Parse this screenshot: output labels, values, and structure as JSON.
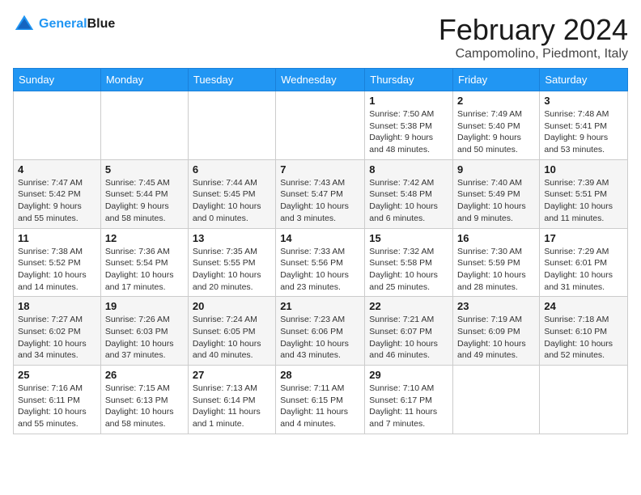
{
  "header": {
    "logo_line1": "General",
    "logo_line2": "Blue",
    "month_year": "February 2024",
    "location": "Campomolino, Piedmont, Italy"
  },
  "weekdays": [
    "Sunday",
    "Monday",
    "Tuesday",
    "Wednesday",
    "Thursday",
    "Friday",
    "Saturday"
  ],
  "weeks": [
    [
      {
        "day": "",
        "info": ""
      },
      {
        "day": "",
        "info": ""
      },
      {
        "day": "",
        "info": ""
      },
      {
        "day": "",
        "info": ""
      },
      {
        "day": "1",
        "info": "Sunrise: 7:50 AM\nSunset: 5:38 PM\nDaylight: 9 hours\nand 48 minutes."
      },
      {
        "day": "2",
        "info": "Sunrise: 7:49 AM\nSunset: 5:40 PM\nDaylight: 9 hours\nand 50 minutes."
      },
      {
        "day": "3",
        "info": "Sunrise: 7:48 AM\nSunset: 5:41 PM\nDaylight: 9 hours\nand 53 minutes."
      }
    ],
    [
      {
        "day": "4",
        "info": "Sunrise: 7:47 AM\nSunset: 5:42 PM\nDaylight: 9 hours\nand 55 minutes."
      },
      {
        "day": "5",
        "info": "Sunrise: 7:45 AM\nSunset: 5:44 PM\nDaylight: 9 hours\nand 58 minutes."
      },
      {
        "day": "6",
        "info": "Sunrise: 7:44 AM\nSunset: 5:45 PM\nDaylight: 10 hours\nand 0 minutes."
      },
      {
        "day": "7",
        "info": "Sunrise: 7:43 AM\nSunset: 5:47 PM\nDaylight: 10 hours\nand 3 minutes."
      },
      {
        "day": "8",
        "info": "Sunrise: 7:42 AM\nSunset: 5:48 PM\nDaylight: 10 hours\nand 6 minutes."
      },
      {
        "day": "9",
        "info": "Sunrise: 7:40 AM\nSunset: 5:49 PM\nDaylight: 10 hours\nand 9 minutes."
      },
      {
        "day": "10",
        "info": "Sunrise: 7:39 AM\nSunset: 5:51 PM\nDaylight: 10 hours\nand 11 minutes."
      }
    ],
    [
      {
        "day": "11",
        "info": "Sunrise: 7:38 AM\nSunset: 5:52 PM\nDaylight: 10 hours\nand 14 minutes."
      },
      {
        "day": "12",
        "info": "Sunrise: 7:36 AM\nSunset: 5:54 PM\nDaylight: 10 hours\nand 17 minutes."
      },
      {
        "day": "13",
        "info": "Sunrise: 7:35 AM\nSunset: 5:55 PM\nDaylight: 10 hours\nand 20 minutes."
      },
      {
        "day": "14",
        "info": "Sunrise: 7:33 AM\nSunset: 5:56 PM\nDaylight: 10 hours\nand 23 minutes."
      },
      {
        "day": "15",
        "info": "Sunrise: 7:32 AM\nSunset: 5:58 PM\nDaylight: 10 hours\nand 25 minutes."
      },
      {
        "day": "16",
        "info": "Sunrise: 7:30 AM\nSunset: 5:59 PM\nDaylight: 10 hours\nand 28 minutes."
      },
      {
        "day": "17",
        "info": "Sunrise: 7:29 AM\nSunset: 6:01 PM\nDaylight: 10 hours\nand 31 minutes."
      }
    ],
    [
      {
        "day": "18",
        "info": "Sunrise: 7:27 AM\nSunset: 6:02 PM\nDaylight: 10 hours\nand 34 minutes."
      },
      {
        "day": "19",
        "info": "Sunrise: 7:26 AM\nSunset: 6:03 PM\nDaylight: 10 hours\nand 37 minutes."
      },
      {
        "day": "20",
        "info": "Sunrise: 7:24 AM\nSunset: 6:05 PM\nDaylight: 10 hours\nand 40 minutes."
      },
      {
        "day": "21",
        "info": "Sunrise: 7:23 AM\nSunset: 6:06 PM\nDaylight: 10 hours\nand 43 minutes."
      },
      {
        "day": "22",
        "info": "Sunrise: 7:21 AM\nSunset: 6:07 PM\nDaylight: 10 hours\nand 46 minutes."
      },
      {
        "day": "23",
        "info": "Sunrise: 7:19 AM\nSunset: 6:09 PM\nDaylight: 10 hours\nand 49 minutes."
      },
      {
        "day": "24",
        "info": "Sunrise: 7:18 AM\nSunset: 6:10 PM\nDaylight: 10 hours\nand 52 minutes."
      }
    ],
    [
      {
        "day": "25",
        "info": "Sunrise: 7:16 AM\nSunset: 6:11 PM\nDaylight: 10 hours\nand 55 minutes."
      },
      {
        "day": "26",
        "info": "Sunrise: 7:15 AM\nSunset: 6:13 PM\nDaylight: 10 hours\nand 58 minutes."
      },
      {
        "day": "27",
        "info": "Sunrise: 7:13 AM\nSunset: 6:14 PM\nDaylight: 11 hours\nand 1 minute."
      },
      {
        "day": "28",
        "info": "Sunrise: 7:11 AM\nSunset: 6:15 PM\nDaylight: 11 hours\nand 4 minutes."
      },
      {
        "day": "29",
        "info": "Sunrise: 7:10 AM\nSunset: 6:17 PM\nDaylight: 11 hours\nand 7 minutes."
      },
      {
        "day": "",
        "info": ""
      },
      {
        "day": "",
        "info": ""
      }
    ]
  ]
}
